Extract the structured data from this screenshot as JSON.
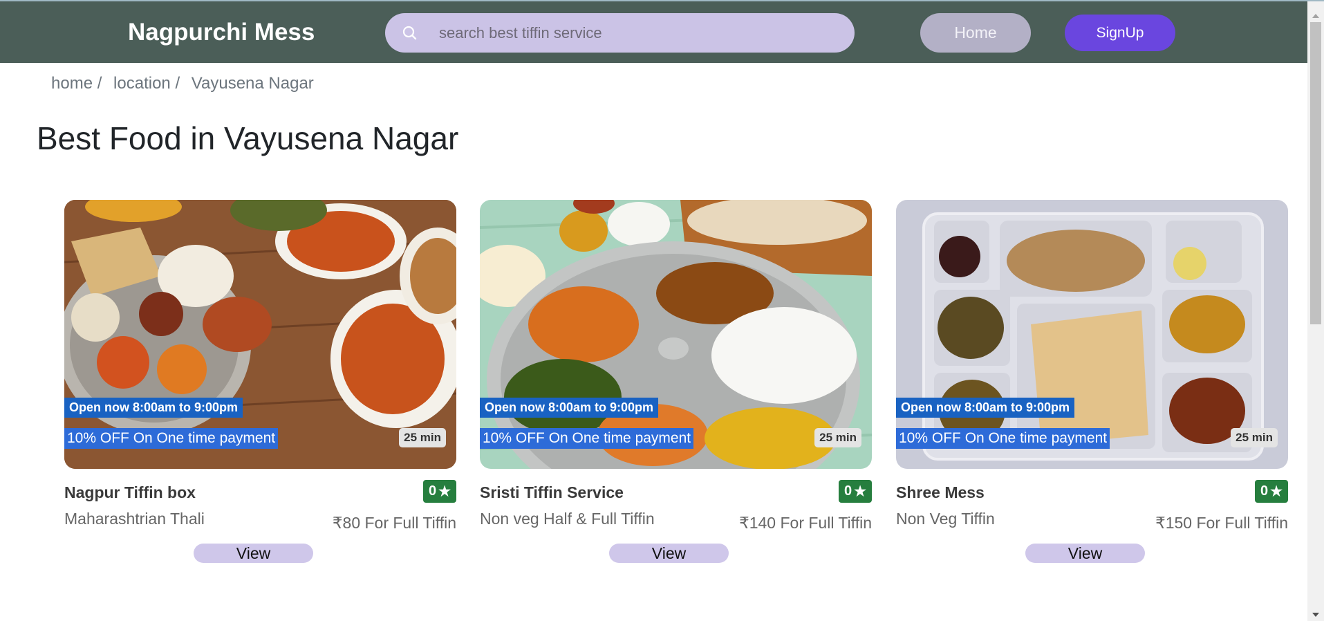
{
  "header": {
    "brand": "Nagpurchi Mess",
    "search_placeholder": "search best tiffin service",
    "home_label": "Home",
    "signup_label": "SignUp"
  },
  "breadcrumb": [
    "home /",
    "location /",
    "Vayusena Nagar"
  ],
  "page_title": "Best Food in Vayusena Nagar",
  "cards": [
    {
      "open_hours": "Open now 8:00am to 9:00pm",
      "offer": "10% OFF On One time payment",
      "delivery_time": "25 min",
      "name": "Nagpur Tiffin box",
      "rating": "0",
      "cuisine": "Maharashtrian Thali",
      "price": "₹80 For Full Tiffin",
      "view_label": "View"
    },
    {
      "open_hours": "Open now 8:00am to 9:00pm",
      "offer": "10% OFF On One time payment",
      "delivery_time": "25 min",
      "name": "Sristi Tiffin Service",
      "rating": "0",
      "cuisine": "Non veg Half & Full Tiffin",
      "price": "₹140 For Full Tiffin",
      "view_label": "View"
    },
    {
      "open_hours": "Open now 8:00am to 9:00pm",
      "offer": "10% OFF On One time payment",
      "delivery_time": "25 min",
      "name": "Shree Mess",
      "rating": "0",
      "cuisine": "Non Veg Tiffin",
      "price": "₹150 For Full Tiffin",
      "view_label": "View"
    }
  ],
  "icons": {
    "search": "search-icon",
    "rating": "star-icon"
  },
  "colors": {
    "navbar": "#4b5e58",
    "search_bg": "#cbc3e6",
    "signup": "#6a46df",
    "home_button": "#b3b0c6",
    "open_badge": "#1962c2",
    "offer_badge": "#2d6bd8",
    "rating": "#267e3e",
    "view_button": "#cfc7ea"
  }
}
